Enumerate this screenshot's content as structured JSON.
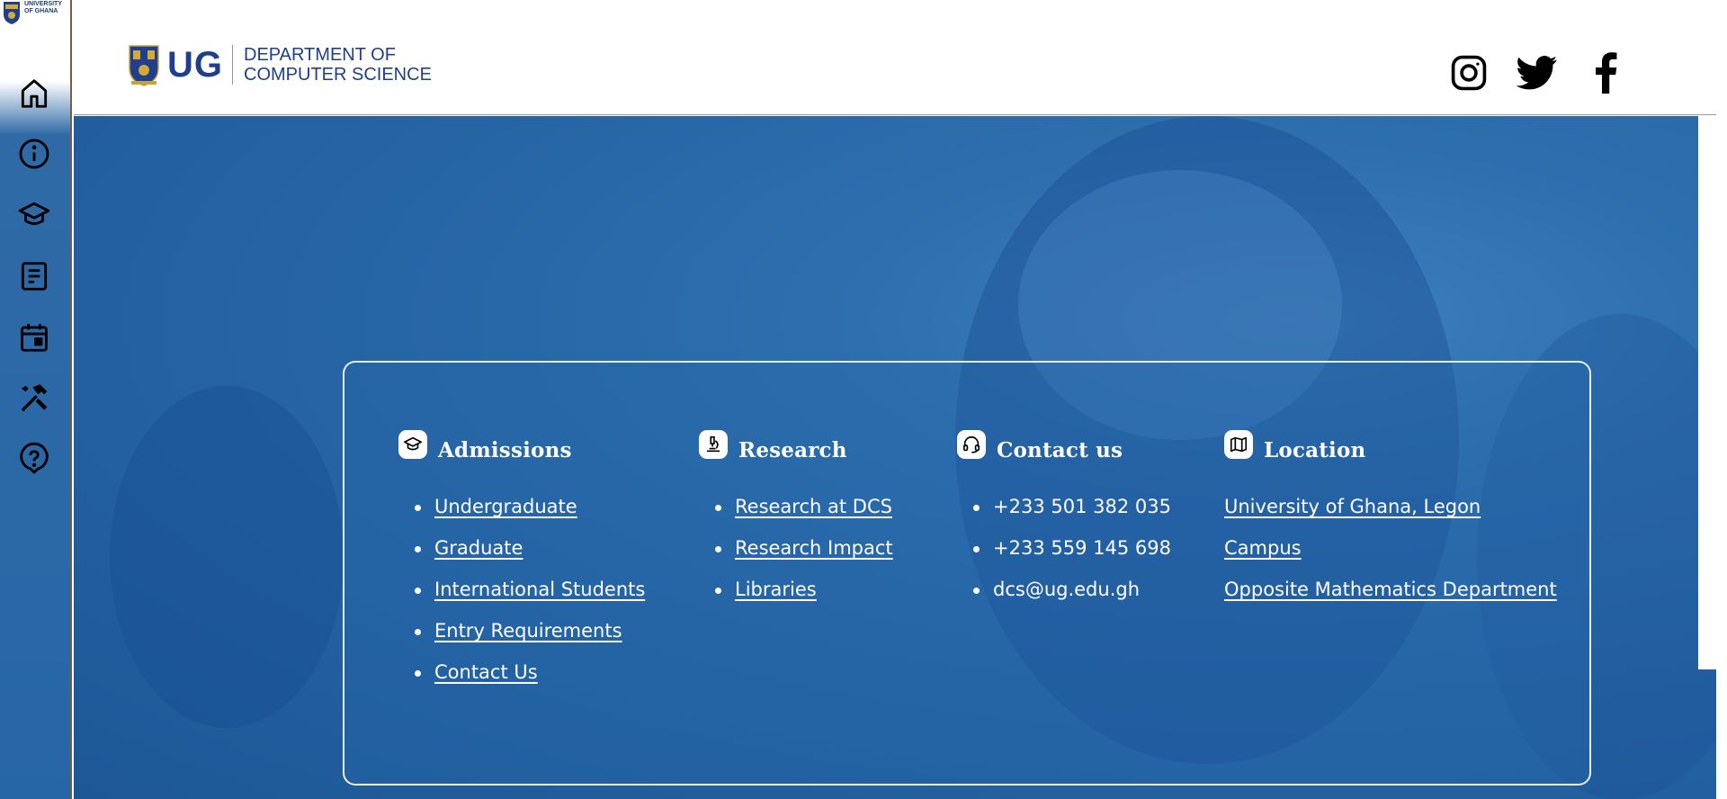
{
  "brand": {
    "mini_text_line1": "UNIVERSITY",
    "mini_text_line2": "OF GHANA",
    "ug": "UG",
    "dept_line1": "DEPARTMENT OF",
    "dept_line2": "COMPUTER SCIENCE",
    "colors": {
      "primary": "#1f3f8a",
      "hero": "#2766a6"
    }
  },
  "sidebar": {
    "items": [
      {
        "name": "home",
        "icon": "home-icon"
      },
      {
        "name": "about",
        "icon": "info-icon"
      },
      {
        "name": "academics",
        "icon": "graduation-cap-icon"
      },
      {
        "name": "news",
        "icon": "document-icon"
      },
      {
        "name": "events",
        "icon": "calendar-icon"
      },
      {
        "name": "facilities",
        "icon": "tools-icon"
      },
      {
        "name": "help",
        "icon": "help-icon"
      }
    ]
  },
  "social": {
    "items": [
      {
        "name": "instagram",
        "icon": "instagram-icon"
      },
      {
        "name": "twitter",
        "icon": "twitter-icon"
      },
      {
        "name": "facebook",
        "icon": "facebook-icon"
      }
    ]
  },
  "footer": {
    "admissions": {
      "title": "Admissions",
      "links": [
        "Undergraduate",
        "Graduate",
        "International Students",
        "Entry Requirements",
        "Contact Us"
      ]
    },
    "research": {
      "title": "Research",
      "links": [
        "Research at DCS",
        "Research Impact",
        "Libraries"
      ]
    },
    "contact": {
      "title": "Contact us",
      "items": [
        "+233 501 382 035",
        "+233 559 145 698",
        "dcs@ug.edu.gh"
      ]
    },
    "location": {
      "title": "Location",
      "lines": [
        "University of Ghana, Legon",
        "Campus",
        "Opposite Mathematics Department"
      ]
    }
  }
}
